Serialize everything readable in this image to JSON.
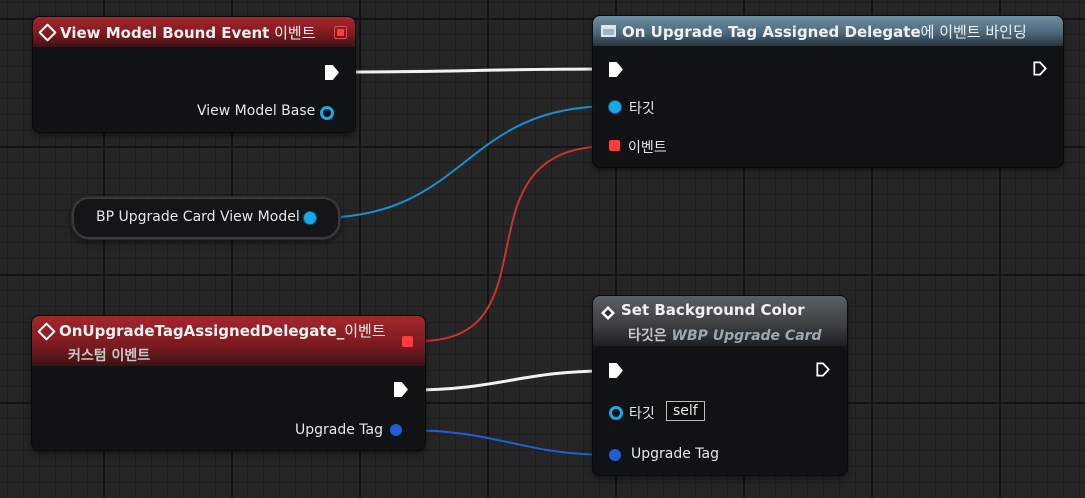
{
  "colors": {
    "exec": "#ffffff",
    "object_pin": "#1aa7ec",
    "delegate_pin": "#ff3c3c",
    "struct_pin": "#1f5fd6",
    "wire_delegate": "#c83232"
  },
  "nodes": {
    "view_model_bound": {
      "icon": "event-diamond-icon",
      "title": "View Model Bound Event",
      "title_suffix": " 이벤트",
      "pin_view_model_base": "View Model Base"
    },
    "bind_event": {
      "icon": "window-icon",
      "title": "On Upgrade Tag Assigned Delegate",
      "title_suffix": "에 이벤트 바인딩",
      "pin_target": "타깃",
      "pin_event": "이벤트"
    },
    "variable": {
      "label": "BP Upgrade Card View Model"
    },
    "custom_event": {
      "icon": "event-diamond-icon",
      "title": "OnUpgradeTagAssignedDelegate_",
      "title_suffix": "이벤트",
      "subtitle": "커스텀 이벤트",
      "pin_upgrade_tag": "Upgrade Tag"
    },
    "set_bg_color": {
      "icon": "function-icon",
      "title": "Set Background Color",
      "subtitle_prefix": "타깃은 ",
      "subtitle_target": "WBP Upgrade Card",
      "pin_target": "타깃",
      "pin_target_value": "self",
      "pin_upgrade_tag": "Upgrade Tag"
    }
  }
}
